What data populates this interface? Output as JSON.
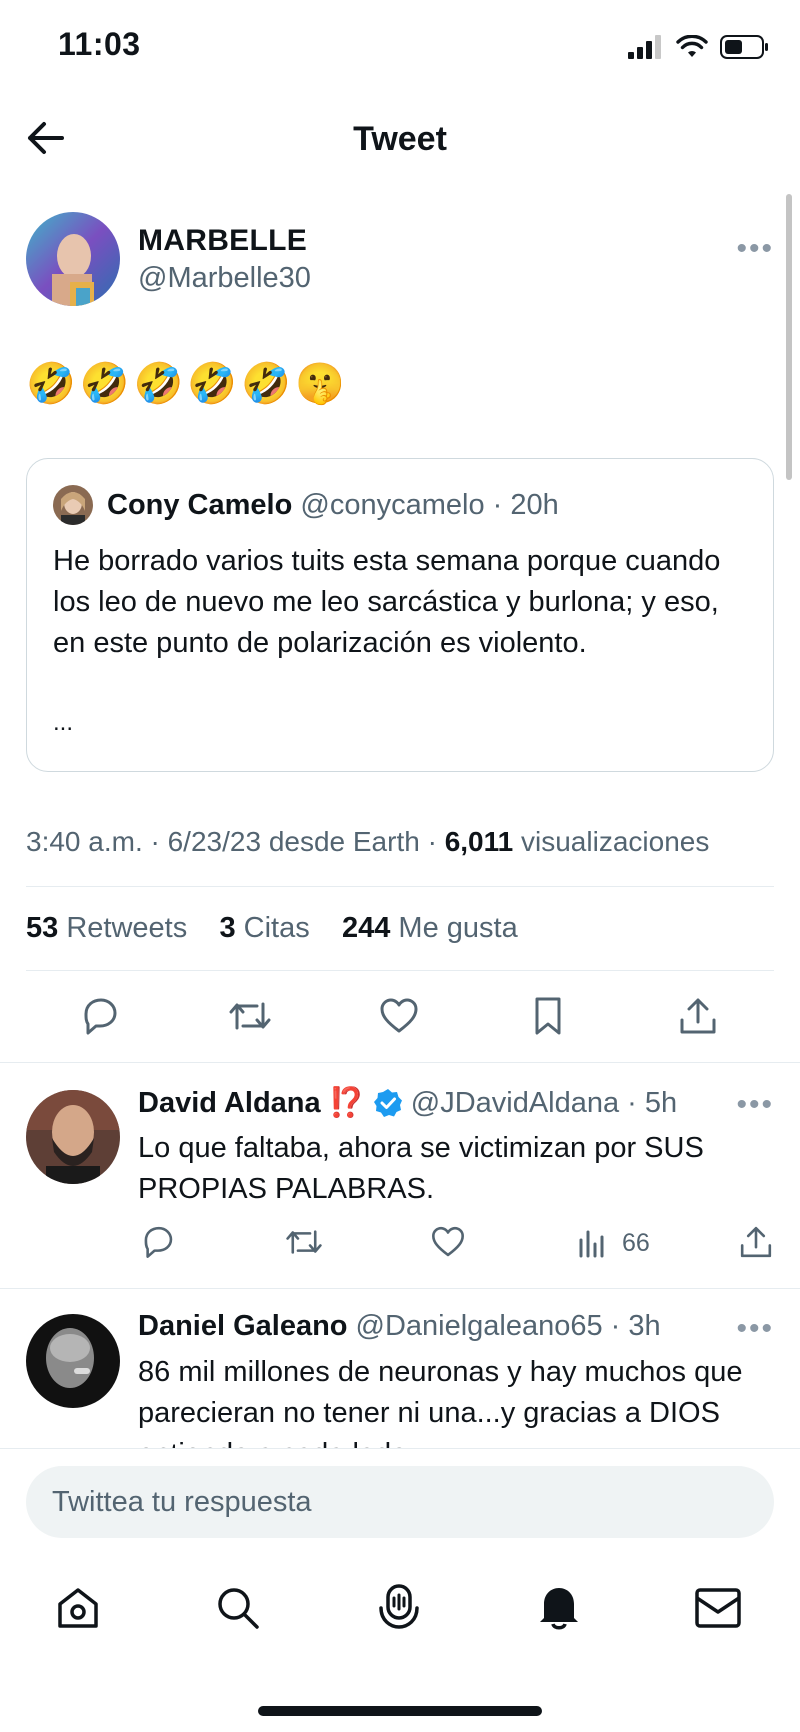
{
  "status_bar": {
    "time": "11:03"
  },
  "header": {
    "title": "Tweet"
  },
  "tweet": {
    "author_name": "MARBELLE",
    "author_handle": "@Marbelle30",
    "text": "🤣🤣🤣🤣🤣🤫",
    "quoted": {
      "name": "Cony Camelo",
      "handle": "@conycamelo",
      "time": "· 20h",
      "text": "He borrado varios tuits esta semana porque cuando los leo de nuevo me leo sarcástica y burlona; y eso, en este punto de polarización es violento.",
      "more": "..."
    },
    "timestamp": "3:40 a.m. · 6/23/23 desde Earth ·",
    "views_count": "6,011",
    "views_label": "visualizaciones",
    "retweets_count": "53",
    "retweets_label": "Retweets",
    "quotes_count": "3",
    "quotes_label": "Citas",
    "likes_count": "244",
    "likes_label": "Me gusta"
  },
  "replies": [
    {
      "name": "David Aldana",
      "emoji": "⁉️",
      "handle": "@JDavidAldana",
      "time": "· 5h",
      "text": "Lo que faltaba, ahora se victimizan por SUS PROPIAS PALABRAS.",
      "views": "66"
    },
    {
      "name": "Daniel Galeano",
      "handle": "@Danielgaleano65",
      "time": "· 3h",
      "text": "86 mil millones de neuronas y hay muchos que parecieran no tener ni una...y gracias a DIOS entiendo a cada lado"
    }
  ],
  "composer": {
    "placeholder": "Twittea tu respuesta"
  },
  "colors": {
    "text": "#0f1419",
    "secondary": "#536471",
    "verified": "#1d9bf0",
    "border": "#cfd9de"
  }
}
